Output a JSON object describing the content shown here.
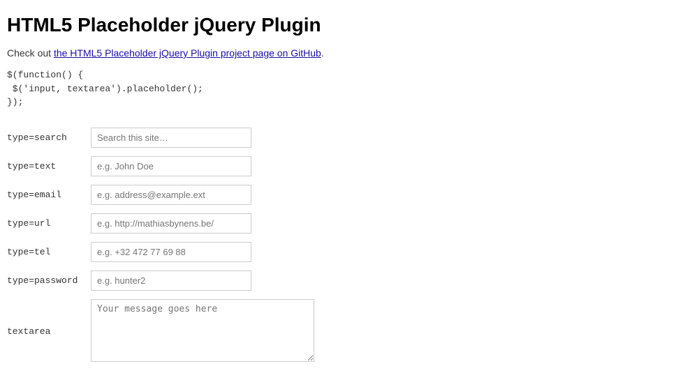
{
  "page": {
    "title": "HTML5 Placeholder jQuery Plugin",
    "intro_text": "Check out ",
    "link_text": "the HTML5 Placeholder jQuery Plugin project page on GitHub",
    "link_href": "#",
    "intro_text_end": ".",
    "code": "$(function() {\n $('input, textarea').placeholder();\n});"
  },
  "fields": [
    {
      "label": "type=search",
      "type": "search",
      "placeholder": "Search this site…"
    },
    {
      "label": "type=text",
      "type": "text",
      "placeholder": "e.g. John Doe"
    },
    {
      "label": "type=email",
      "type": "email",
      "placeholder": "e.g. address@example.ext"
    },
    {
      "label": "type=url",
      "type": "url",
      "placeholder": "e.g. http://mathiasbynens.be/"
    },
    {
      "label": "type=tel",
      "type": "tel",
      "placeholder": "e.g. +32 472 77 69 88"
    },
    {
      "label": "type=password",
      "type": "password",
      "placeholder": "e.g. hunter2"
    }
  ],
  "textarea": {
    "label": "textarea",
    "placeholder": "Your message goes here"
  }
}
